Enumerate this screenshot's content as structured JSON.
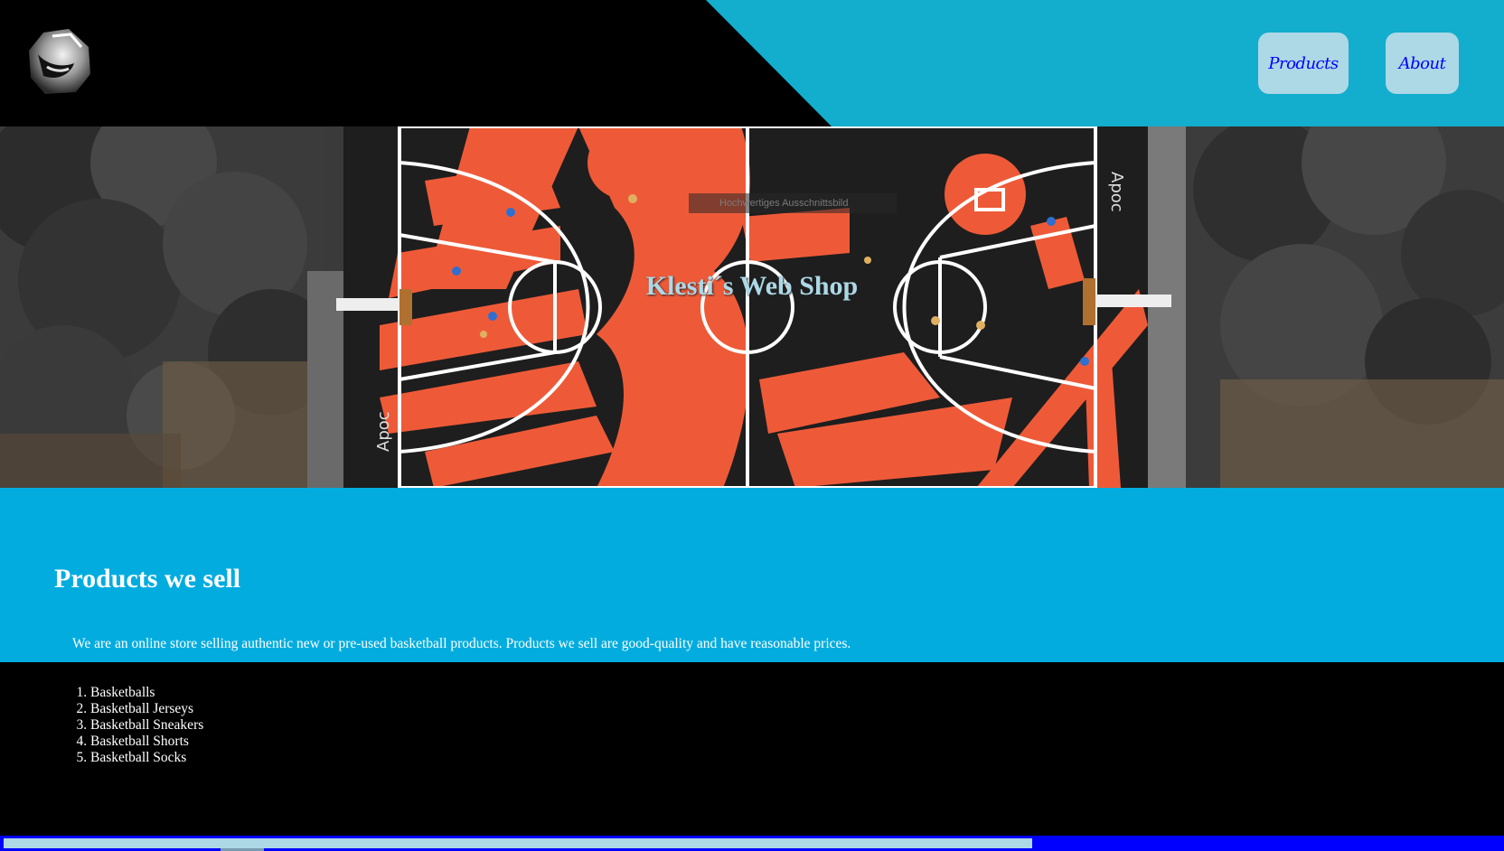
{
  "header": {
    "logo_icon": "sneaker-logo-icon",
    "nav": {
      "products_label": "Products",
      "about_label": "About"
    }
  },
  "hero": {
    "title": "Klesti´s Web Shop",
    "image_alt_fragment": "Hochwertiges Ausschnittsbild"
  },
  "products": {
    "heading": "Products we sell",
    "description": "We are an online store selling authentic new or pre-used basketball products. Products we sell are good-quality and have reasonable prices.",
    "items": [
      "Basketballs",
      "Basketball Jerseys",
      "Basketball Sneakers",
      "Basketball Shorts",
      "Basketball Socks"
    ]
  },
  "colors": {
    "header_accent": "#13adcd",
    "products_bg": "#03acdf",
    "nav_button_bg": "#add8e6",
    "nav_button_text": "#0000ff",
    "hero_title": "#add8e6",
    "page_bg": "#000000",
    "scrollbar_track": "#0000ff",
    "scrollbar_thumb": "#add8e6"
  }
}
